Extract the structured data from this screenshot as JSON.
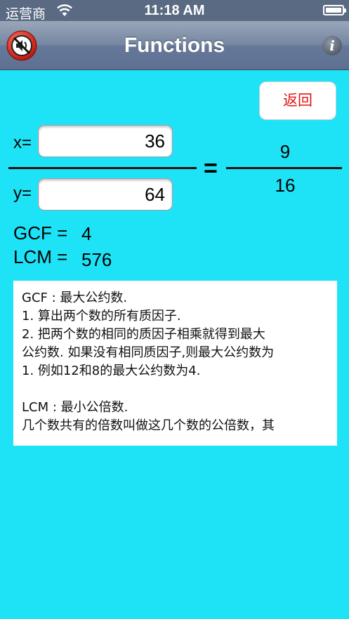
{
  "status_bar": {
    "carrier": "运营商",
    "time": "11:18 AM"
  },
  "nav": {
    "title": "Functions",
    "info_glyph": "i",
    "left_icon": "no-sound-icon",
    "right_icon": "info-icon"
  },
  "back_button": {
    "label": "返回"
  },
  "inputs": {
    "x_label": "x=",
    "x_value": "36",
    "y_label": "y=",
    "y_value": "64"
  },
  "equals": "=",
  "fraction": {
    "numerator": "9",
    "denominator": "16"
  },
  "results": {
    "gcf_label": "GCF =",
    "gcf_value": "4",
    "lcm_label": "LCM =",
    "lcm_value": "576"
  },
  "info_text": {
    "lines": [
      "GCF : 最大公约数.",
      "1. 算出两个数的所有质因子.",
      "2. 把两个数的相同的质因子相乘就得到最大",
      "公约数. 如果没有相同质因子,则最大公约数为",
      "1. 例如12和8的最大公约数为4.",
      "",
      "LCM : 最小公倍数.",
      "几个数共有的倍数叫做这几个数的公倍数，其"
    ]
  },
  "colors": {
    "background": "#1ee3f7",
    "back_button_text": "#e41414"
  }
}
